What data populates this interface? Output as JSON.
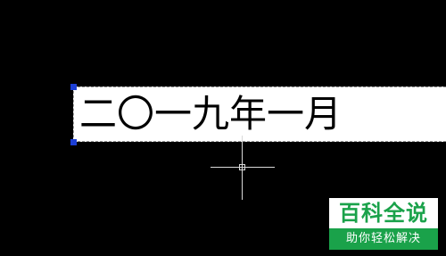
{
  "drawing": {
    "text": "二〇一九年一月"
  },
  "watermark": {
    "title": "百科全说",
    "subtitle": "助你轻松解决"
  },
  "colors": {
    "background": "#000000",
    "grip": "#1c3fd6",
    "watermark_green": "#1aa24a"
  },
  "icons": {
    "cursor": "crosshair-cursor-icon",
    "grip": "grip-handle-icon"
  }
}
